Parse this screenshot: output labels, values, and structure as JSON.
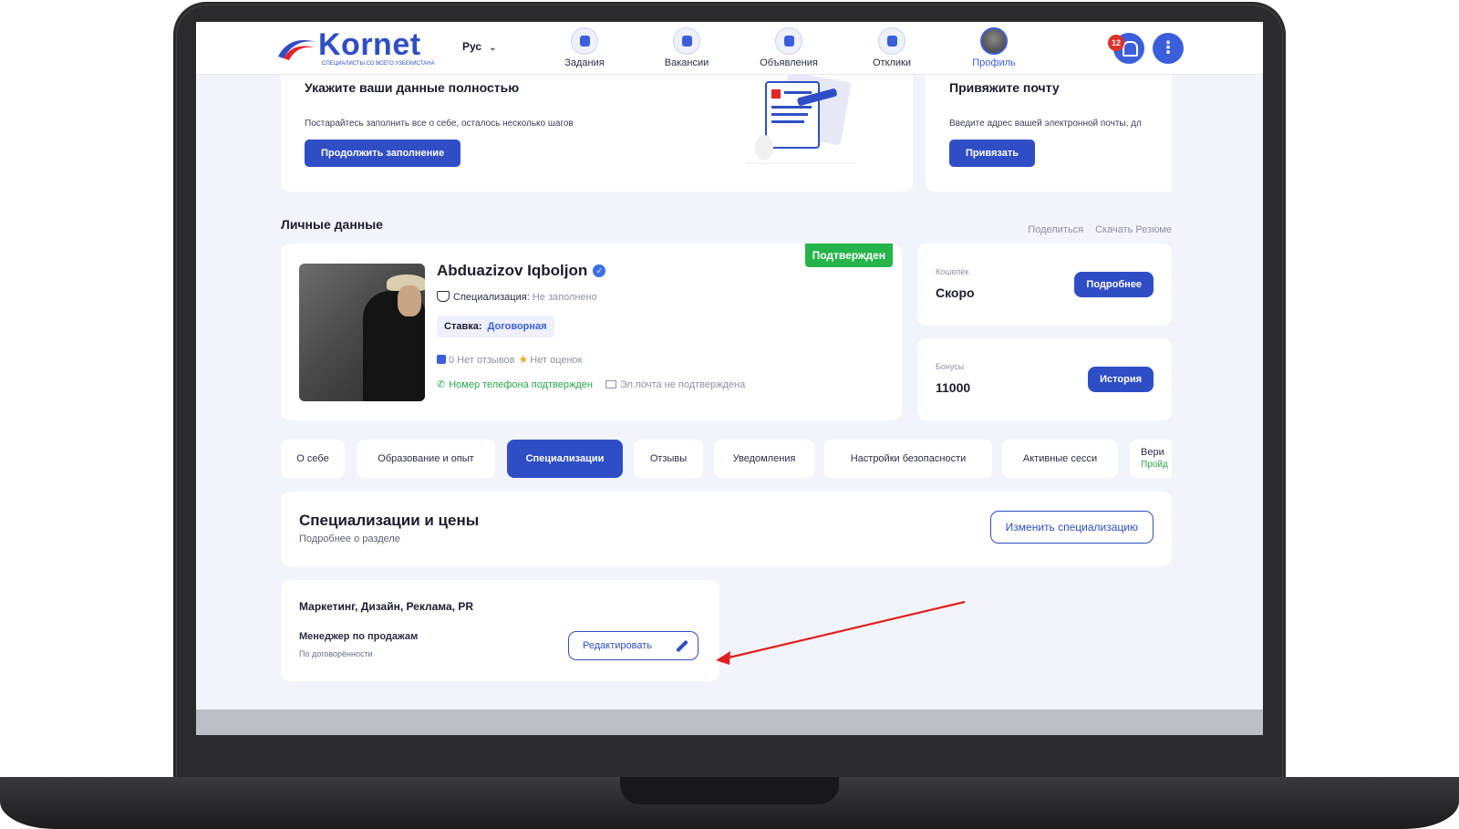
{
  "header": {
    "logo_text": "Kornet",
    "logo_sub": "СПЕЦИАЛИСТЫ СО ВСЕГО УЗБЕКИСТАНА",
    "language": "Рус",
    "nav": [
      {
        "label": "Задания",
        "icon": "tasks-icon"
      },
      {
        "label": "Вакансии",
        "icon": "vacancies-icon"
      },
      {
        "label": "Объявления",
        "icon": "announcements-icon"
      },
      {
        "label": "Отклики",
        "icon": "responses-icon"
      },
      {
        "label": "Профиль",
        "icon": "profile-avatar"
      }
    ],
    "notification_count": "12",
    "menu_glyph": "⋮"
  },
  "promo": {
    "left": {
      "title": "Укажите ваши данные полностью",
      "desc": "Постарайтесь заполнить все о себе, осталось несколько шагов",
      "button": "Продолжить заполнение"
    },
    "right": {
      "title": "Привяжите почту",
      "desc": "Введите адрес вашей электронной почты, дл",
      "button": "Привязать"
    }
  },
  "personal": {
    "section_title": "Личные данные",
    "share_link": "Поделиться",
    "download_link": "Скачать Резюме",
    "status": "Подтвержден",
    "name": "Abduazizov Iqboljon",
    "verified_glyph": "✓",
    "spec_label": "Специализация:",
    "spec_value": "Не заполнено",
    "rate_label": "Ставка:",
    "rate_value": "Договорная",
    "reviews": "0 Нет отзывов",
    "ratings": "Нет оценок",
    "star_glyph": "★",
    "phone_glyph": "✆",
    "phone_status": "Номер телефона подтвержден",
    "email_status": "Эл.почта не подтверждена"
  },
  "wallet": {
    "label": "Кошелёк",
    "value": "Скоро",
    "button": "Подробнее"
  },
  "bonus": {
    "label": "Бонусы",
    "value": "11000",
    "button": "История"
  },
  "tabs": [
    {
      "label": "О себе"
    },
    {
      "label": "Образование и опыт"
    },
    {
      "label": "Специализации"
    },
    {
      "label": "Отзывы"
    },
    {
      "label": "Уведомления"
    },
    {
      "label": "Настройки безопасности"
    },
    {
      "label": "Активные сесси"
    },
    {
      "label": "Вери",
      "sub": "Пройд"
    }
  ],
  "specializations": {
    "title": "Специализации и цены",
    "subtitle": "Подробнее о разделе",
    "change_button": "Изменить специализацию",
    "card": {
      "category": "Маркетинг, Дизайн, Реклама, PR",
      "job": "Менеджер по продажам",
      "price": "По договорённости",
      "edit_button": "Редактировать"
    }
  },
  "colors": {
    "brand": "#2f4ec6",
    "success": "#25b44a",
    "annotation_arrow": "#e0201c"
  }
}
